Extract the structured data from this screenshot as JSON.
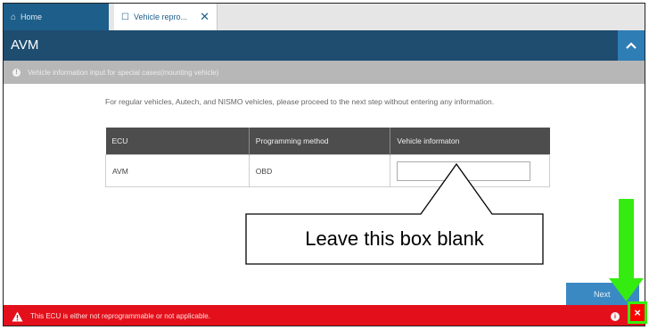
{
  "tabs": [
    {
      "label": "Home",
      "icon": "home-icon"
    },
    {
      "label": "Vehicle repro...",
      "icon": "window-icon",
      "close": "✕"
    }
  ],
  "header": {
    "title": "AVM"
  },
  "info_bar": {
    "icon": "info-icon",
    "text": "Vehicle information input for special cases(mounting vehicle)"
  },
  "instruction": "For regular vehicles, Autech, and NISMO vehicles, please proceed to the next step without entering any information.",
  "table": {
    "columns": [
      "ECU",
      "Programming method",
      "Vehicle informaton"
    ],
    "rows": [
      {
        "ecu": "AVM",
        "method": "OBD",
        "vehicle_info": ""
      }
    ]
  },
  "callout": {
    "text": "Leave this box blank"
  },
  "next_label": "Next",
  "error_bar": {
    "text": "This ECU is either not reprogrammable or not applicable.",
    "info_icon": "i",
    "close": "×"
  },
  "colors": {
    "header": "#1e4d70",
    "accent": "#3a89c3",
    "error": "#e3101b",
    "highlight_arrow": "#35ec11"
  }
}
